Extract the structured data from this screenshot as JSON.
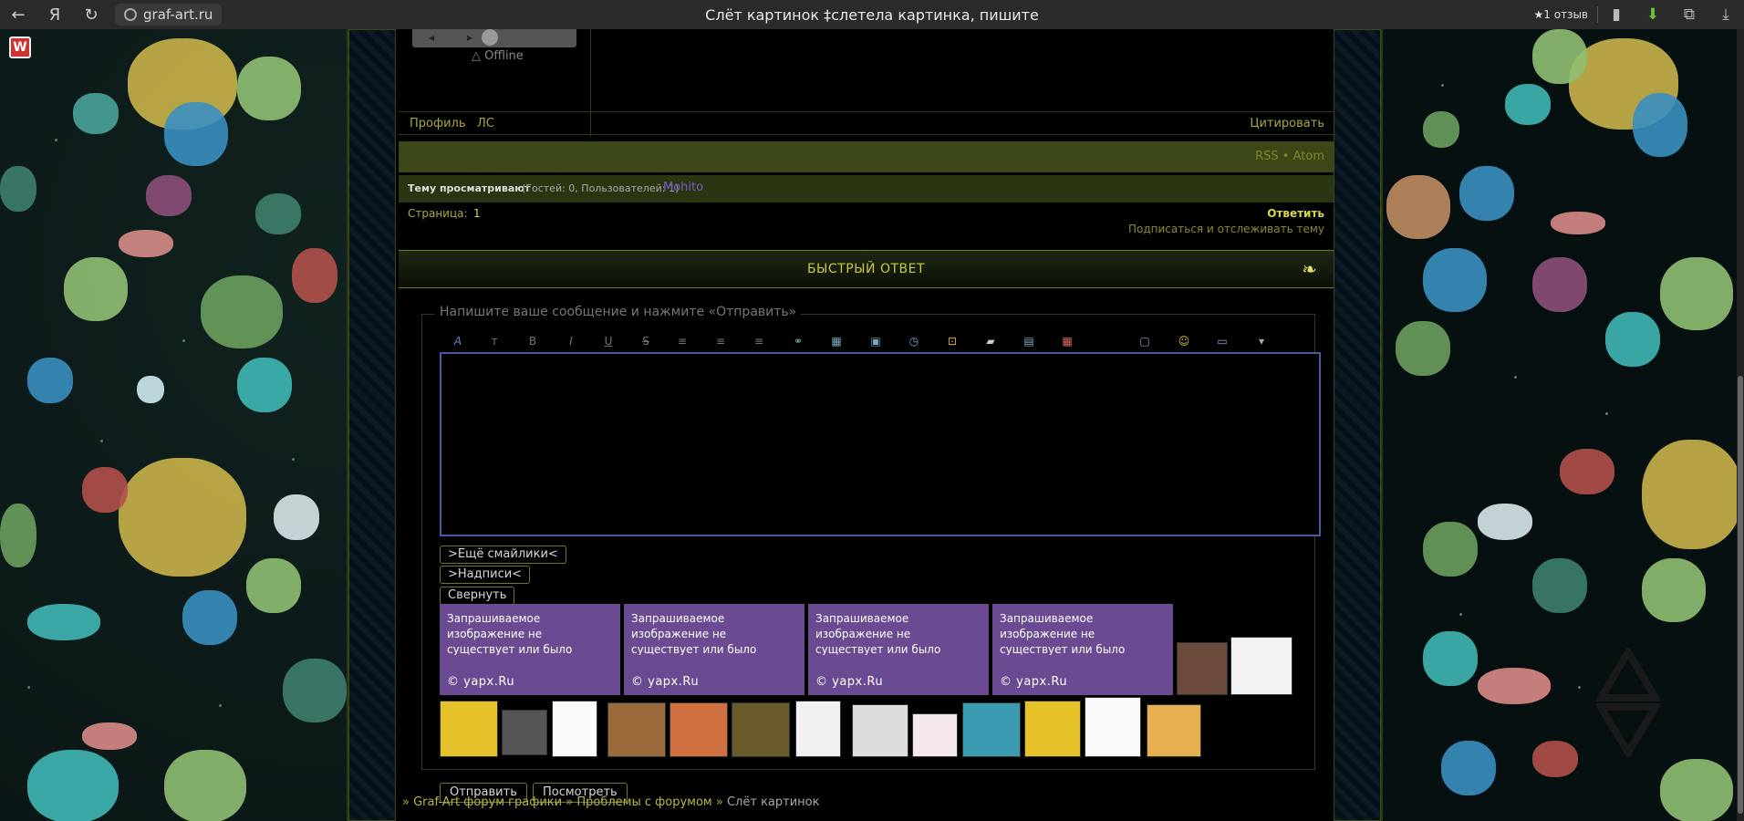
{
  "browser": {
    "back_icon": "back-arrow-icon",
    "yandex": "Я",
    "url": "graf-art.ru",
    "title": "Слёт картинок ‡слетела картинка, пишите",
    "review": "★1 отзыв"
  },
  "post": {
    "status": "Offline",
    "profile_link": "Профиль",
    "pm_link": "ЛС",
    "quote_link": "Цитировать"
  },
  "feeds": {
    "rss": "RSS",
    "sep": "•",
    "atom": "Atom"
  },
  "viewers": {
    "label": "Тему просматривают",
    "counts": "(Гостей: 0, Пользователей: 1)",
    "user": "Mohito"
  },
  "pages": {
    "label": "Страница:",
    "current": "1",
    "reply": "Ответить",
    "subscribe": "Подписаться и отслеживать тему"
  },
  "quick_reply": {
    "title": "БЫСТРЫЙ ОТВЕТ",
    "legend": "Напишите ваше сообщение и нажмите «Отправить»",
    "more_smileys": ">Ещё смайлики<",
    "captions": ">Надписи<",
    "collapse": "Свернуть",
    "send": "Отправить",
    "preview": "Посмотреть"
  },
  "yapx": {
    "text": "Запрашиваемое изображение не существует или было удалено пользователем",
    "credit": "© yapx.Ru"
  },
  "breadcrumb": {
    "start": "»",
    "forum": "Graf-Art форум графики",
    "section": "Проблемы с форумом",
    "topic": "Слёт картинок",
    "sep": "»"
  }
}
